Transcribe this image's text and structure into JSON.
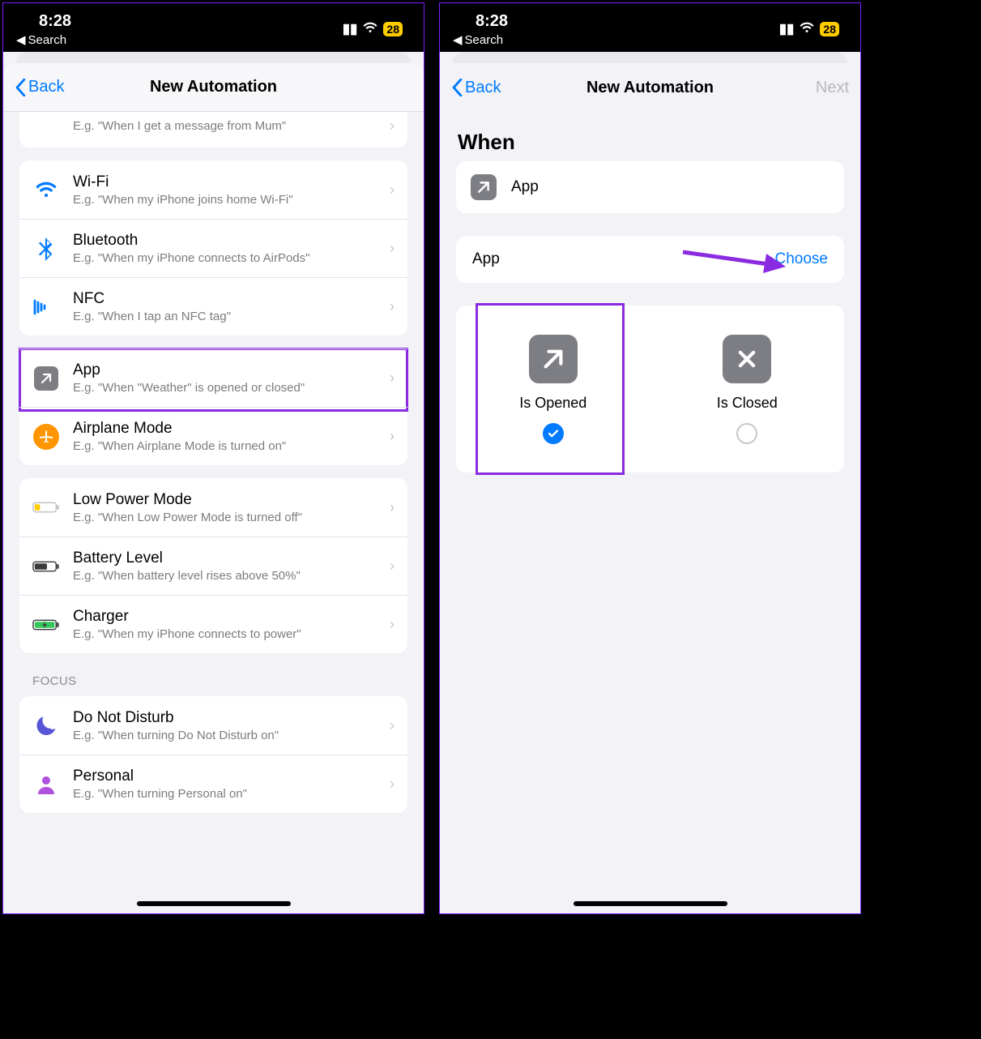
{
  "status": {
    "time": "8:28",
    "search": "Search",
    "battery": "28"
  },
  "left": {
    "nav": {
      "back": "Back",
      "title": "New Automation"
    },
    "partial_sub": "E.g. \"When I get a message from Mum\"",
    "groups": [
      [
        {
          "icon": "wifi",
          "title": "Wi-Fi",
          "sub": "E.g. \"When my iPhone joins home Wi-Fi\""
        },
        {
          "icon": "bluetooth",
          "title": "Bluetooth",
          "sub": "E.g. \"When my iPhone connects to AirPods\""
        },
        {
          "icon": "nfc",
          "title": "NFC",
          "sub": "E.g. \"When I tap an NFC tag\""
        }
      ],
      [
        {
          "icon": "app",
          "title": "App",
          "sub": "E.g. \"When \"Weather\" is opened or closed\""
        },
        {
          "icon": "airplane",
          "title": "Airplane Mode",
          "sub": "E.g. \"When Airplane Mode is turned on\""
        }
      ],
      [
        {
          "icon": "lowpower",
          "title": "Low Power Mode",
          "sub": "E.g. \"When Low Power Mode is turned off\""
        },
        {
          "icon": "battery",
          "title": "Battery Level",
          "sub": "E.g. \"When battery level rises above 50%\""
        },
        {
          "icon": "charger",
          "title": "Charger",
          "sub": "E.g. \"When my iPhone connects to power\""
        }
      ]
    ],
    "focus_header": "FOCUS",
    "focus_rows": [
      {
        "icon": "moon",
        "title": "Do Not Disturb",
        "sub": "E.g. \"When turning Do Not Disturb on\""
      },
      {
        "icon": "person",
        "title": "Personal",
        "sub": "E.g. \"When turning Personal on\""
      }
    ]
  },
  "right": {
    "nav": {
      "back": "Back",
      "title": "New Automation",
      "next": "Next"
    },
    "when": "When",
    "app_label": "App",
    "choose_label": "App",
    "choose_link": "Choose",
    "option_open": "Is Opened",
    "option_closed": "Is Closed"
  }
}
